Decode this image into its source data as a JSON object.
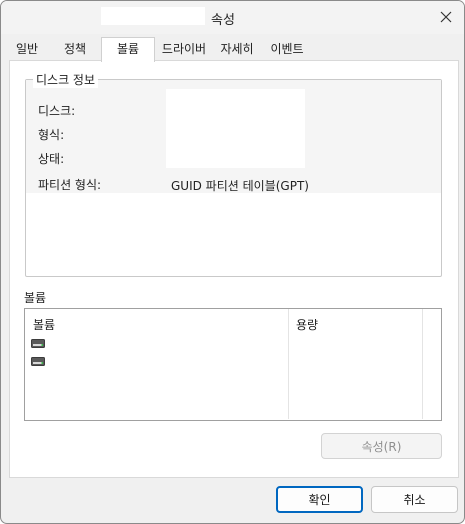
{
  "window": {
    "title": "속성"
  },
  "tabs": [
    {
      "label": "일반",
      "active": false
    },
    {
      "label": "정책",
      "active": false
    },
    {
      "label": "볼륨",
      "active": true
    },
    {
      "label": "드라이버",
      "active": false
    },
    {
      "label": "자세히",
      "active": false
    },
    {
      "label": "이벤트",
      "active": false
    }
  ],
  "disk_info": {
    "group_title": "디스크 정보",
    "fields": [
      {
        "label": "디스크:",
        "value": ""
      },
      {
        "label": "형식:",
        "value": ""
      },
      {
        "label": "상태:",
        "value": ""
      },
      {
        "label": "파티션 형식:",
        "value": "GUID 파티션 테이블(GPT)"
      }
    ]
  },
  "volumes": {
    "section_label": "볼륨",
    "columns": [
      "볼륨",
      "용량"
    ],
    "rows": [
      {
        "icon": "drive-icon",
        "volume": "",
        "capacity": ""
      },
      {
        "icon": "drive-icon",
        "volume": "",
        "capacity": ""
      }
    ],
    "properties_button": "속성(R)",
    "properties_enabled": false
  },
  "footer": {
    "ok_label": "확인",
    "cancel_label": "취소"
  },
  "colors": {
    "accent": "#0067c0",
    "dialog_bg": "#f0f0f0",
    "panel_bg": "#ffffff"
  }
}
